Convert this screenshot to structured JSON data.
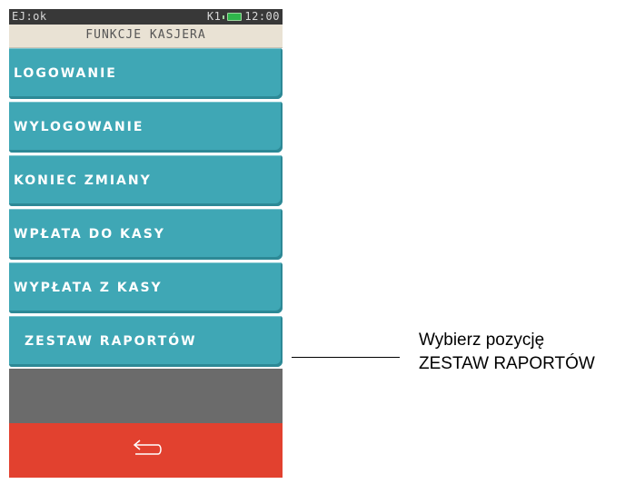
{
  "status_bar": {
    "left_text": "EJ:ok",
    "indicator": "K1",
    "time": "12:00",
    "battery_icon": "battery-icon"
  },
  "title": "FUNKCJE KASJERA",
  "menu": {
    "items": [
      {
        "label": "LOGOWANIE"
      },
      {
        "label": "WYLOGOWANIE"
      },
      {
        "label": "KONIEC ZMIANY"
      },
      {
        "label": "WPŁATA DO KASY"
      },
      {
        "label": "WYPŁATA Z KASY"
      },
      {
        "label": "ZESTAW RAPORTÓW"
      }
    ]
  },
  "back_button": {
    "icon": "back-arrow-icon"
  },
  "callout": {
    "line1": "Wybierz pozycję",
    "line2": "ZESTAW RAPORTÓW"
  },
  "colors": {
    "menu_item": "#3fa7b5",
    "back_bar": "#e2412f",
    "title_bar": "#e9e2d4",
    "status_bar": "#383838",
    "gray_area": "#6b6b6b"
  }
}
